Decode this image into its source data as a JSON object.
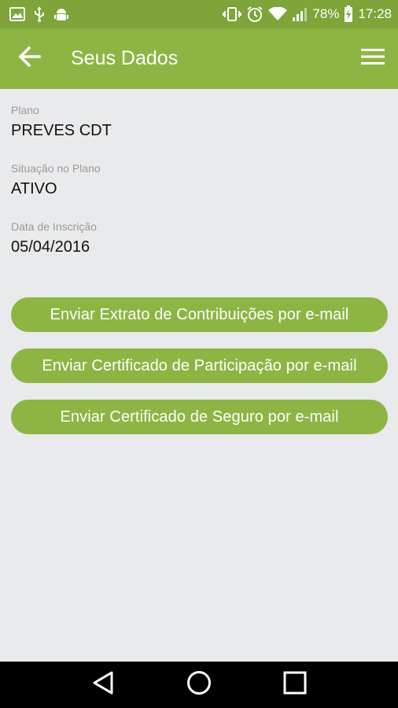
{
  "status_bar": {
    "battery": "78%",
    "time": "17:28"
  },
  "app_bar": {
    "title": "Seus Dados"
  },
  "fields": [
    {
      "label": "Plano",
      "value": "PREVES CDT"
    },
    {
      "label": "Situação no Plano",
      "value": "ATIVO"
    },
    {
      "label": "Data de Inscrição",
      "value": "05/04/2016"
    }
  ],
  "buttons": [
    {
      "label": "Enviar Extrato de Contribuições por e-mail"
    },
    {
      "label": "Enviar Certificado de Participação por e-mail"
    },
    {
      "label": "Enviar Certificado de Seguro por e-mail"
    }
  ],
  "colors": {
    "status_bar": "#7ea43a",
    "app_bar": "#8db544",
    "button": "#8db544",
    "background": "#e9eaec"
  }
}
